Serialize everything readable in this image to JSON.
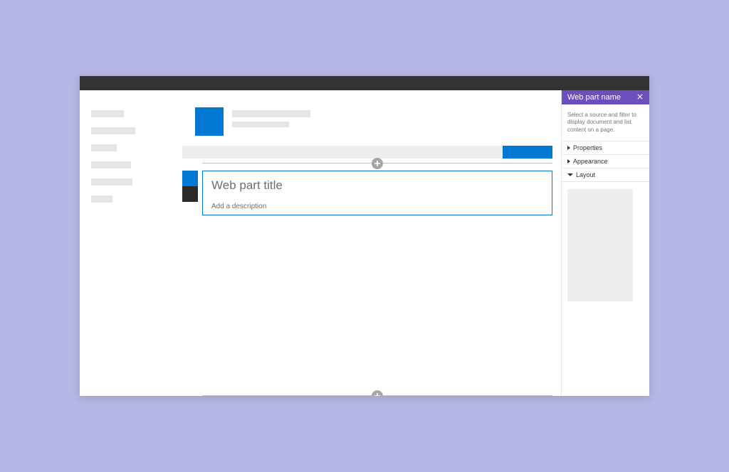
{
  "panel": {
    "title": "Web part name",
    "description": "Select a source and filter to display document and list content on a page.",
    "sections": {
      "properties": "Properties",
      "appearance": "Appearance",
      "layout": "Layout"
    }
  },
  "webpart": {
    "title_placeholder": "Web part title",
    "description_placeholder": "Add a description"
  },
  "colors": {
    "accent": "#0078d4",
    "panel_accent": "#6b4fbb"
  }
}
